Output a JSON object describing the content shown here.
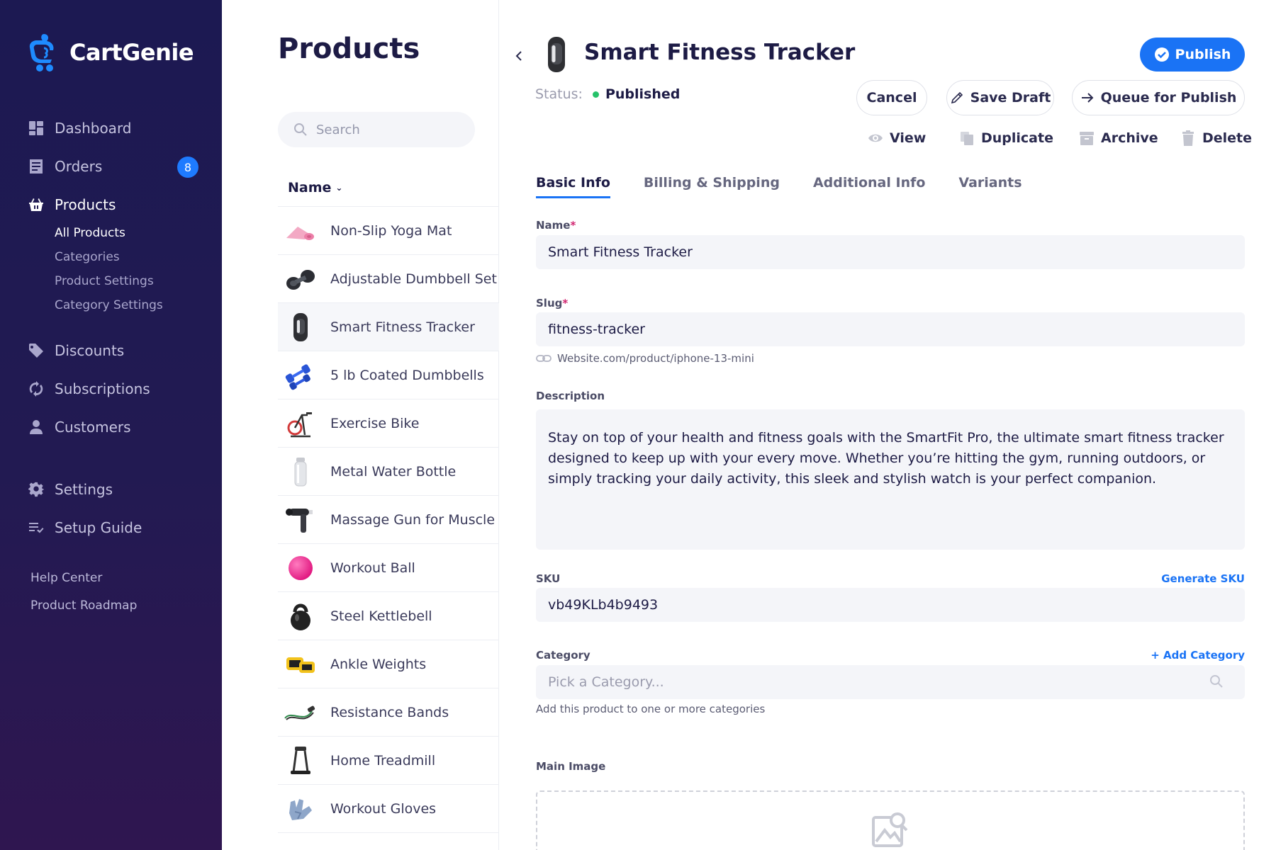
{
  "app": {
    "name": "CartGenie"
  },
  "sidebar": {
    "items": [
      {
        "label": "Dashboard",
        "icon": "dashboard-icon"
      },
      {
        "label": "Orders",
        "icon": "orders-icon",
        "badge": "8"
      },
      {
        "label": "Products",
        "icon": "basket-icon",
        "active": true,
        "children": [
          {
            "label": "All Products",
            "active": true
          },
          {
            "label": "Categories"
          },
          {
            "label": "Product Settings"
          },
          {
            "label": "Category Settings"
          }
        ]
      },
      {
        "label": "Discounts",
        "icon": "tag-icon"
      },
      {
        "label": "Subscriptions",
        "icon": "refresh-icon"
      },
      {
        "label": "Customers",
        "icon": "user-icon"
      },
      {
        "label": "Settings",
        "icon": "gear-icon"
      },
      {
        "label": "Setup Guide",
        "icon": "checklist-icon"
      }
    ],
    "footer": [
      {
        "label": "Help Center"
      },
      {
        "label": "Product Roadmap"
      }
    ]
  },
  "products_panel": {
    "title": "Products",
    "search_placeholder": "Search",
    "sort_label": "Name",
    "items": [
      {
        "name": "Non-Slip Yoga Mat",
        "thumb": "yoga-mat"
      },
      {
        "name": "Adjustable Dumbbell Set",
        "thumb": "dumbbell-set"
      },
      {
        "name": "Smart Fitness Tracker",
        "thumb": "fitness-tracker",
        "selected": true
      },
      {
        "name": "5 lb Coated Dumbbells",
        "thumb": "coated-dumbbells"
      },
      {
        "name": "Exercise Bike",
        "thumb": "exercise-bike"
      },
      {
        "name": "Metal Water Bottle",
        "thumb": "water-bottle"
      },
      {
        "name": "Massage Gun for Muscle",
        "thumb": "massage-gun"
      },
      {
        "name": "Workout Ball",
        "thumb": "workout-ball"
      },
      {
        "name": "Steel Kettlebell",
        "thumb": "kettlebell"
      },
      {
        "name": "Ankle Weights",
        "thumb": "ankle-weights"
      },
      {
        "name": "Resistance Bands",
        "thumb": "resistance-bands"
      },
      {
        "name": "Home Treadmill",
        "thumb": "treadmill"
      },
      {
        "name": "Workout Gloves",
        "thumb": "gloves"
      }
    ]
  },
  "detail": {
    "title": "Smart Fitness Tracker",
    "status_label": "Status:",
    "status_value": "Published",
    "buttons": {
      "publish": "Publish",
      "cancel": "Cancel",
      "save_draft": "Save Draft",
      "queue": "Queue for Publish"
    },
    "actions": {
      "view": "View",
      "duplicate": "Duplicate",
      "archive": "Archive",
      "delete": "Delete"
    },
    "tabs": [
      {
        "label": "Basic Info",
        "active": true
      },
      {
        "label": "Billing & Shipping"
      },
      {
        "label": "Additional Info"
      },
      {
        "label": "Variants"
      }
    ],
    "form": {
      "name_label": "Name",
      "name_value": "Smart Fitness Tracker",
      "slug_label": "Slug",
      "slug_value": "fitness-tracker",
      "slug_url": "Website.com/product/iphone-13-mini",
      "description_label": "Description",
      "description_value": "Stay on top of your health and fitness goals with the SmartFit Pro, the ultimate smart fitness tracker designed to keep up with your every move. Whether you’re hitting the gym, running outdoors, or simply tracking your daily activity, this sleek and stylish watch is your perfect companion.",
      "sku_label": "SKU",
      "sku_value": "vb49KLb4b9493",
      "generate_sku": "Generate SKU",
      "category_label": "Category",
      "add_category": "+ Add Category",
      "category_placeholder": "Pick a Category...",
      "category_helper": "Add this product to one or more categories",
      "main_image_label": "Main Image"
    }
  },
  "colors": {
    "sidebar_bg": "#1c1952",
    "accent": "#1a73f5",
    "status_published": "#26c26a",
    "required": "#d0246f"
  }
}
